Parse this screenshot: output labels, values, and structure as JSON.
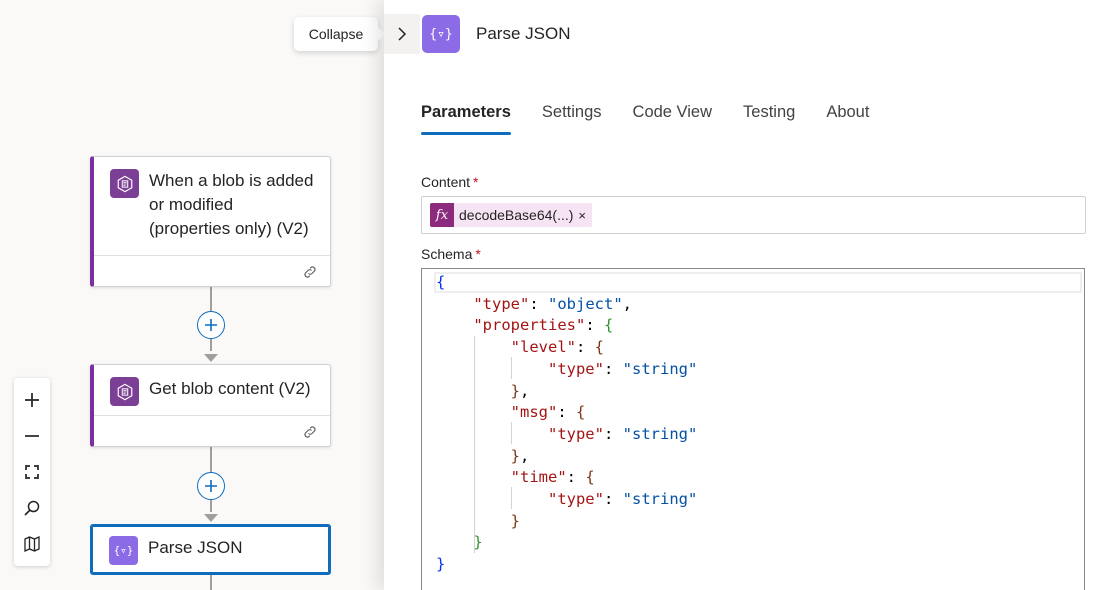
{
  "canvas": {
    "nodes": [
      {
        "title": "When a blob is added or modified (properties only) (V2)"
      },
      {
        "title": "Get blob content (V2)"
      },
      {
        "title": "Parse JSON"
      }
    ],
    "zoom_controls": [
      "zoom-in-icon",
      "zoom-out-icon",
      "fit-view-icon",
      "search-icon",
      "minimap-icon"
    ]
  },
  "tooltip": {
    "collapse": "Collapse"
  },
  "panel": {
    "title": "Parse JSON",
    "tabs": [
      {
        "label": "Parameters",
        "active": true
      },
      {
        "label": "Settings",
        "active": false
      },
      {
        "label": "Code View",
        "active": false
      },
      {
        "label": "Testing",
        "active": false
      },
      {
        "label": "About",
        "active": false
      }
    ],
    "content": {
      "label": "Content",
      "required": "*",
      "token": {
        "icon": "fx",
        "text": "decodeBase64(...)",
        "remove": "×"
      }
    },
    "schema": {
      "label": "Schema",
      "required": "*",
      "lines": [
        "{",
        "    \"type\": \"object\",",
        "    \"properties\": {",
        "        \"level\": {",
        "            \"type\": \"string\"",
        "        },",
        "        \"msg\": {",
        "            \"type\": \"string\"",
        "        },",
        "        \"time\": {",
        "            \"type\": \"string\"",
        "        }",
        "    }",
        "}"
      ]
    }
  },
  "colors": {
    "accent": "#0f6cbd",
    "connector_purple": "#7b3f96",
    "parse_json_purple": "#8c6be6",
    "expression_token": "#8c2a7e",
    "required": "#c50f1f"
  }
}
